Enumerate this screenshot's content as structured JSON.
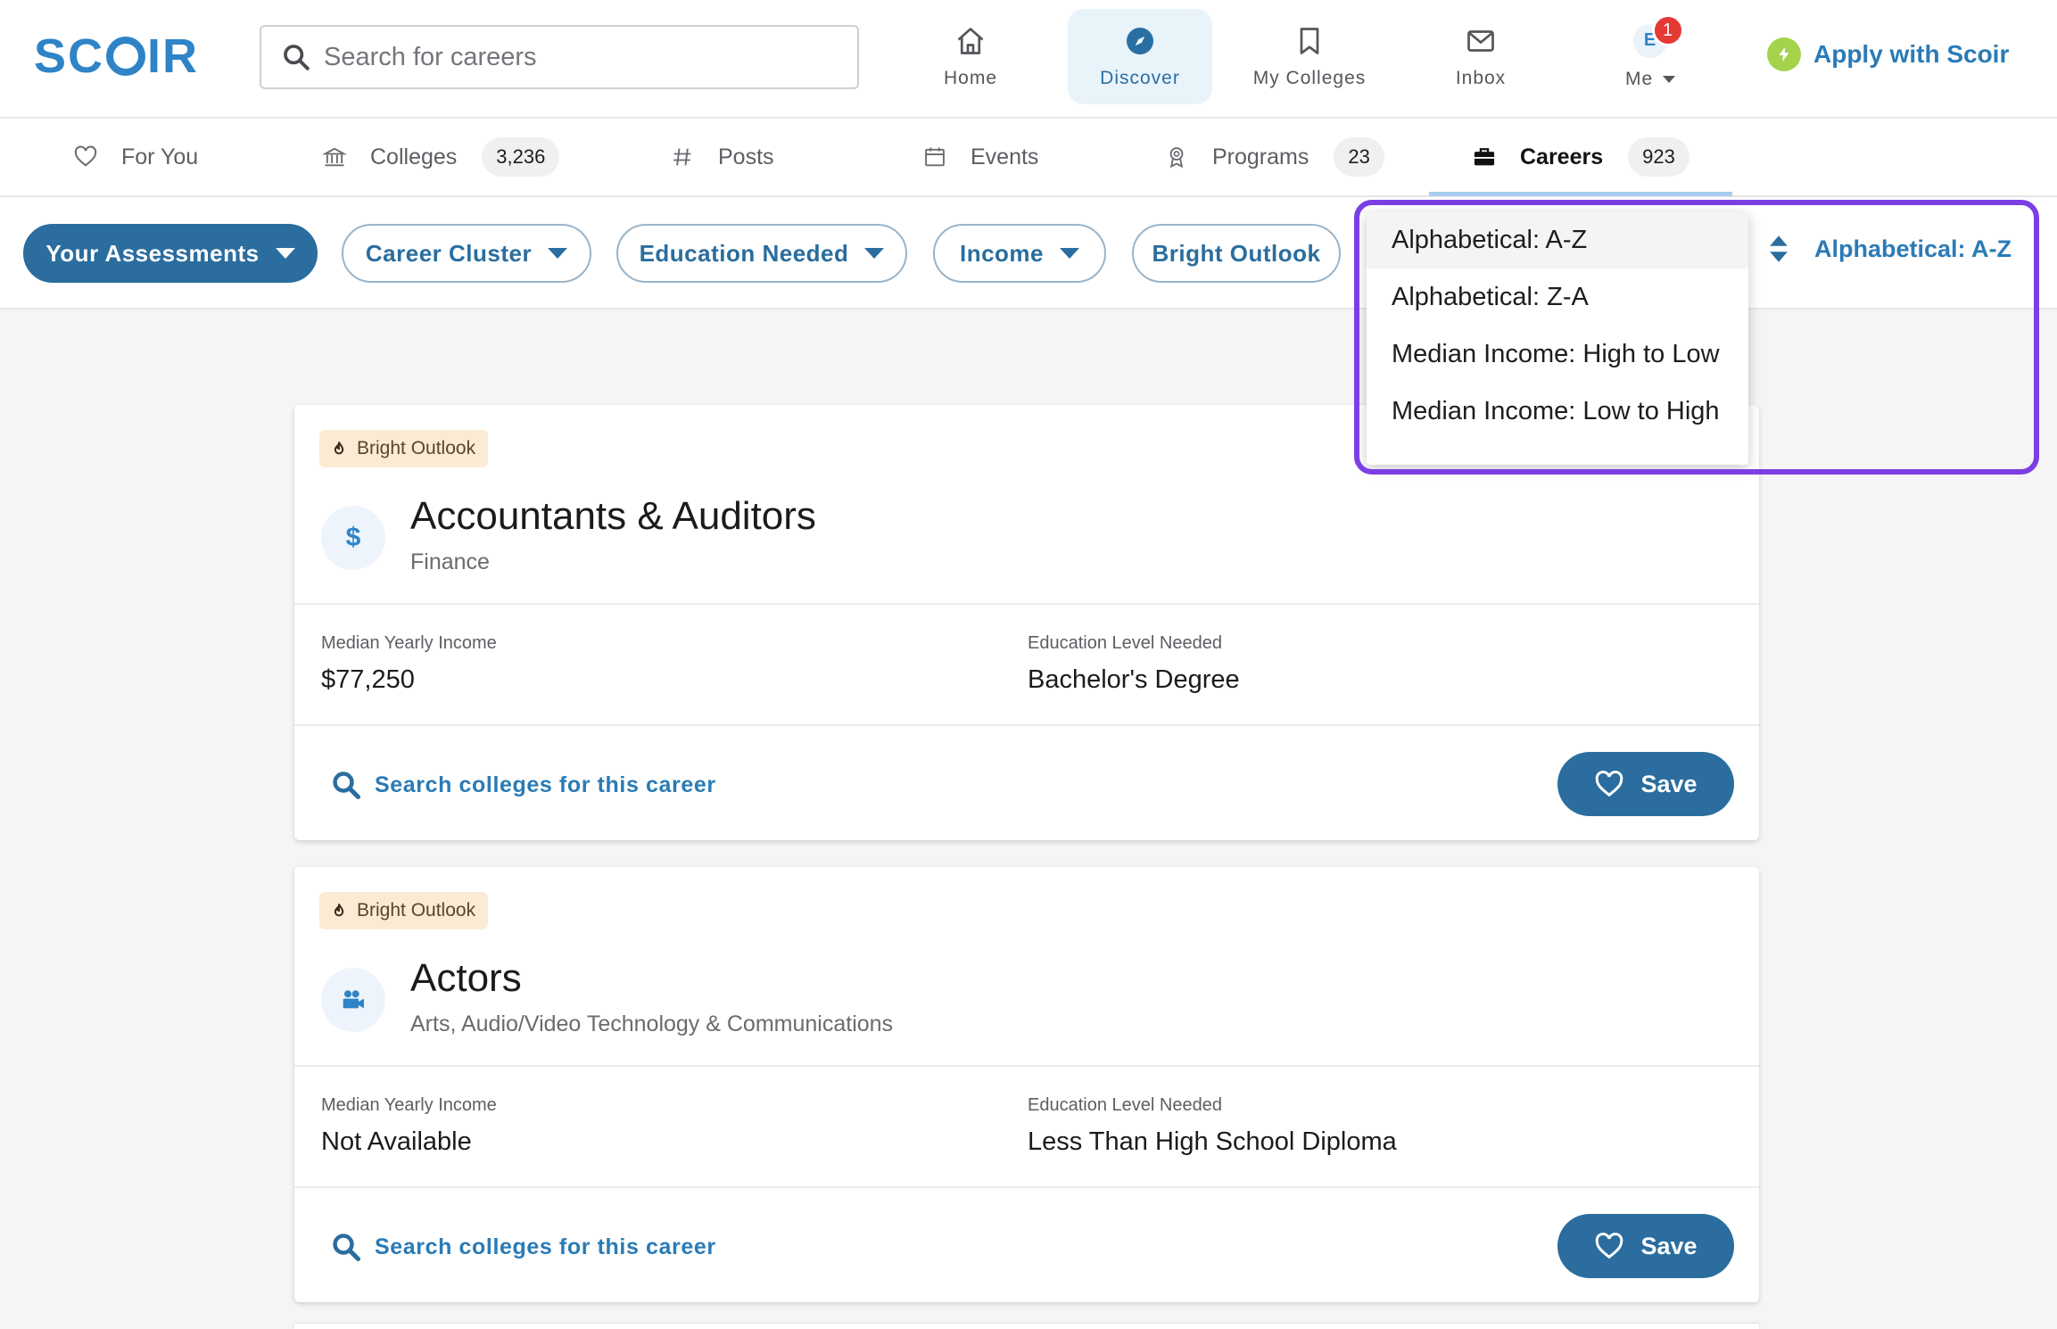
{
  "app": {
    "logo": "SCOIR"
  },
  "header": {
    "search_placeholder": "Search for careers",
    "nav": [
      {
        "label": "Home",
        "icon": "home-icon"
      },
      {
        "label": "Discover",
        "icon": "compass-icon"
      },
      {
        "label": "My Colleges",
        "icon": "bookmark-icon"
      },
      {
        "label": "Inbox",
        "icon": "mail-icon"
      },
      {
        "label": "Me",
        "icon": "avatar",
        "avatar_letter": "E",
        "notification_count": "1"
      }
    ],
    "apply_label": "Apply with Scoir"
  },
  "tabs": [
    {
      "label": "For You",
      "icon": "heart-icon"
    },
    {
      "label": "Colleges",
      "icon": "institution-icon",
      "count": "3,236"
    },
    {
      "label": "Posts",
      "icon": "hash-icon"
    },
    {
      "label": "Events",
      "icon": "calendar-icon"
    },
    {
      "label": "Programs",
      "icon": "award-icon",
      "count": "23"
    },
    {
      "label": "Careers",
      "icon": "briefcase-icon",
      "count": "923"
    }
  ],
  "filters": {
    "assessments": "Your Assessments",
    "career_cluster": "Career Cluster",
    "education_needed": "Education Needed",
    "income": "Income",
    "bright_outlook": "Bright Outlook",
    "sort_label": "Alphabetical: A-Z"
  },
  "sort_menu": {
    "options": [
      "Alphabetical: A-Z",
      "Alphabetical: Z-A",
      "Median Income: High to Low",
      "Median Income: Low to High"
    ],
    "selected": "Alphabetical: A-Z"
  },
  "cards": [
    {
      "badge": "Bright Outlook",
      "icon": "dollar-icon",
      "title": "Accountants & Auditors",
      "cluster": "Finance",
      "income_label": "Median Yearly Income",
      "income": "$77,250",
      "education_label": "Education Level Needed",
      "education": "Bachelor's Degree",
      "search_link": "Search colleges for this career",
      "save_label": "Save"
    },
    {
      "badge": "Bright Outlook",
      "icon": "video-camera-icon",
      "title": "Actors",
      "cluster": "Arts, Audio/Video Technology & Communications",
      "income_label": "Median Yearly Income",
      "income": "Not Available",
      "education_label": "Education Level Needed",
      "education": "Less Than High School Diploma",
      "search_link": "Search colleges for this career",
      "save_label": "Save"
    }
  ],
  "colors": {
    "brand": "#2e84c6",
    "primary_button": "#2a6d9e",
    "highlight": "#7b3fe4",
    "badge_bg": "#fcebd4",
    "notification": "#e53935"
  }
}
